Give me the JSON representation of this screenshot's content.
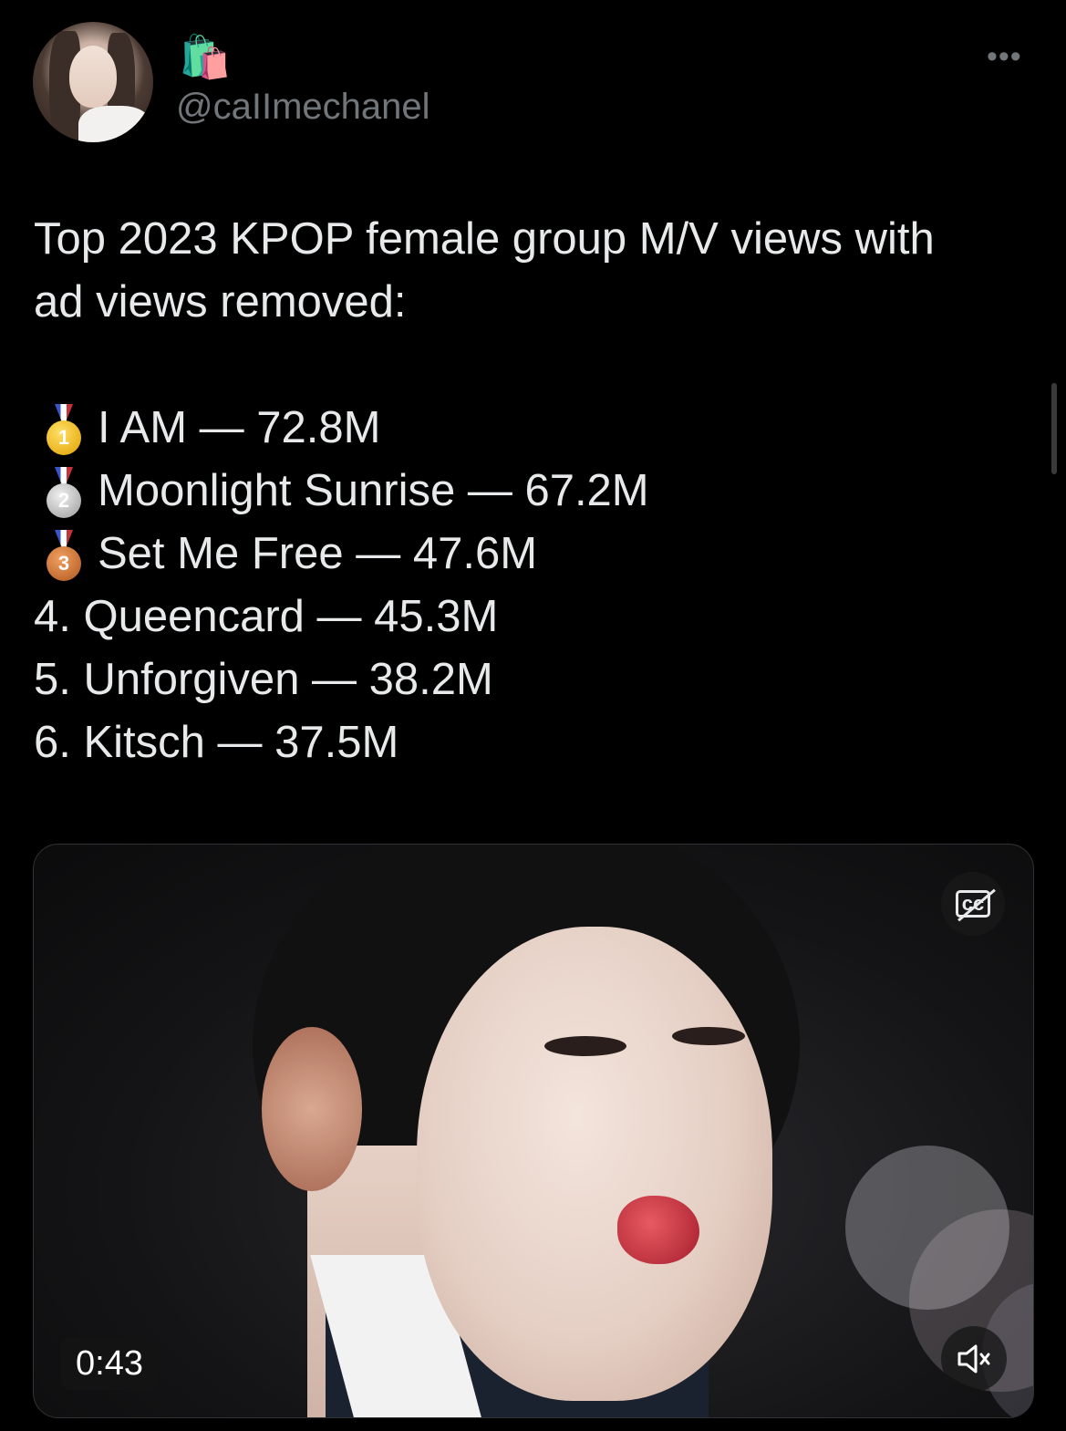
{
  "author": {
    "display_name_emoji": "🛍️",
    "handle": "@caIImechanel",
    "avatar_icon": "avatar"
  },
  "menu_label": "•••",
  "tweet": {
    "intro_line1": "Top 2023 KPOP female group M/V views with",
    "intro_line2": "ad views removed:",
    "ranking": [
      {
        "medal_number": "1",
        "medal": "gold-medal-icon",
        "text": "I AM — 72.8M"
      },
      {
        "medal_number": "2",
        "medal": "silver-medal-icon",
        "text": "Moonlight Sunrise — 67.2M"
      },
      {
        "medal_number": "3",
        "medal": "bronze-medal-icon",
        "text": "Set Me Free — 47.6M"
      },
      {
        "text": "4. Queencard — 45.3M"
      },
      {
        "text": "5. Unforgiven — 38.2M"
      },
      {
        "text": "6. Kitsch — 37.5M"
      }
    ]
  },
  "video": {
    "duration": "0:43",
    "cc_label": "cc",
    "captions_icon": "captions-off-icon",
    "mute_icon": "speaker-muted-icon"
  },
  "colors": {
    "background": "#000000",
    "text": "#e7e9ea",
    "secondary_text": "#71767b"
  }
}
